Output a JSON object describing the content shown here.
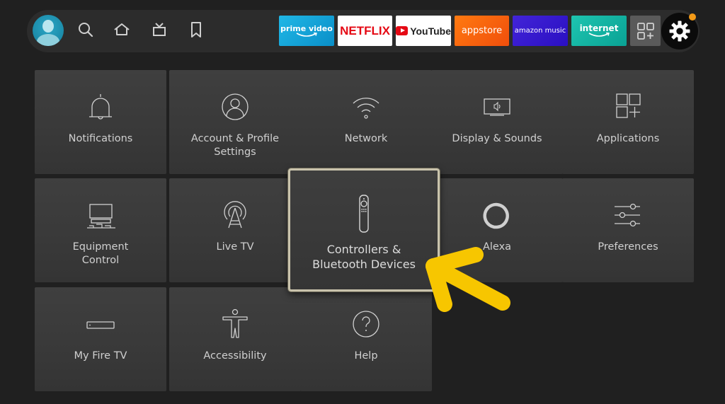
{
  "nav": {
    "profile_icon": "profile-avatar-icon",
    "icons": [
      "search-icon",
      "home-icon",
      "live-tv-icon",
      "bookmark-icon"
    ],
    "apps": [
      {
        "label": "prime video",
        "name": "prime-video",
        "bg": "#0a8fc8"
      },
      {
        "label": "NETFLIX",
        "name": "netflix",
        "bg": "#ffffff"
      },
      {
        "label": "YouTube",
        "name": "youtube",
        "bg": "#ffffff"
      },
      {
        "label": "appstore",
        "name": "appstore",
        "bg": "#f04e0c"
      },
      {
        "label": "amazon music",
        "name": "amazon-music",
        "bg": "#2a0fc2"
      },
      {
        "label": "internet",
        "name": "internet",
        "bg": "#0aa294"
      }
    ],
    "all_apps_icon": "apps-grid-plus-icon",
    "settings_icon": "gear-icon",
    "notification_dot_color": "#f39a17"
  },
  "settings": {
    "focused_item": "Controllers & Bluetooth Devices",
    "items": [
      {
        "label": "Notifications",
        "icon": "bell-icon"
      },
      {
        "label": "Account & Profile Settings",
        "icon": "account-icon"
      },
      {
        "label": "Network",
        "icon": "wifi-icon"
      },
      {
        "label": "Display & Sounds",
        "icon": "display-sound-icon"
      },
      {
        "label": "Applications",
        "icon": "applications-icon"
      },
      {
        "label": "Equipment Control",
        "icon": "equipment-icon"
      },
      {
        "label": "Live TV",
        "icon": "antenna-icon"
      },
      {
        "label": "Controllers & Bluetooth Devices",
        "icon": "remote-icon"
      },
      {
        "label": "Alexa",
        "icon": "alexa-icon"
      },
      {
        "label": "Preferences",
        "icon": "sliders-icon"
      },
      {
        "label": "My Fire TV",
        "icon": "fire-tv-device-icon"
      },
      {
        "label": "Accessibility",
        "icon": "accessibility-icon"
      },
      {
        "label": "Help",
        "icon": "help-icon"
      }
    ]
  },
  "annotation": {
    "type": "arrow",
    "color": "#f7c600",
    "points_to": "Controllers & Bluetooth Devices"
  }
}
